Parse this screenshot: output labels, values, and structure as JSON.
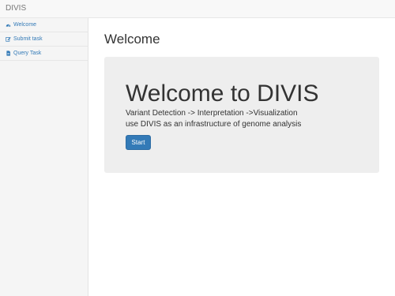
{
  "app": {
    "brand": "DIVIS"
  },
  "sidebar": {
    "items": [
      {
        "label": "Welcome",
        "icon": "dashboard-icon"
      },
      {
        "label": "Submit task",
        "icon": "edit-icon"
      },
      {
        "label": "Query Task",
        "icon": "file-icon"
      }
    ]
  },
  "main": {
    "title": "Welcome",
    "jumbotron": {
      "heading": "Welcome to DIVIS",
      "line1": "Variant Detection -> Interpretation ->Visualization",
      "line2": "use DIVIS as an infrastructure of genome analysis",
      "button_label": "Start"
    }
  },
  "colors": {
    "link": "#337ab7",
    "primary_button": "#337ab7",
    "jumbotron_bg": "#eeeeee",
    "sidebar_bg": "#f5f5f5"
  }
}
